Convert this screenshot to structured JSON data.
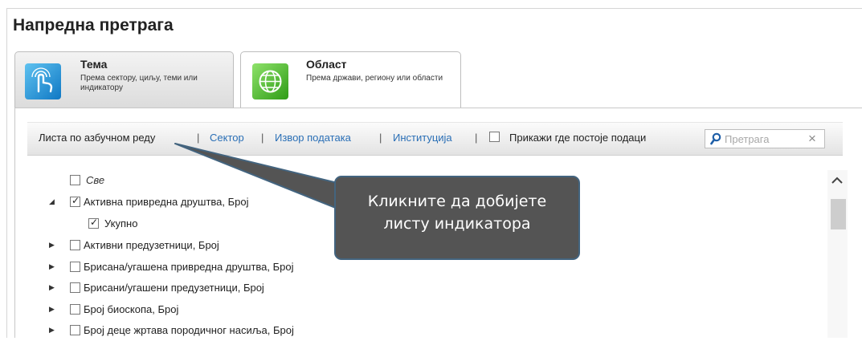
{
  "page": {
    "title": "Напредна претрага"
  },
  "tabs": [
    {
      "title": "Тема",
      "description": "Према сектору, циљу, теми или индикатору",
      "icon": "touch-hand-icon",
      "active": true
    },
    {
      "title": "Област",
      "description": "Према држави, региону или области",
      "icon": "globe-icon",
      "active": false
    }
  ],
  "toolbar": {
    "alphabetical": "Листа по азбучном реду",
    "separator": "|",
    "sector": "Сектор",
    "data_source": "Извор података",
    "institution": "Институција",
    "show_data_label": "Прикажи где постоје подаци",
    "search_placeholder": "Претрага",
    "clear_icon": "×"
  },
  "tree": {
    "all_label": "Све",
    "items": [
      {
        "label": "Активна привредна друштва, Број",
        "expanded": true,
        "checked": true
      },
      {
        "label": "Укупно",
        "child": true,
        "checked": true
      },
      {
        "label": "Активни предузетници, Број",
        "expanded": false,
        "checked": false
      },
      {
        "label": "Брисана/угашена привредна друштва, Број",
        "expanded": false,
        "checked": false
      },
      {
        "label": "Брисани/угашени предузетници, Број",
        "expanded": false,
        "checked": false
      },
      {
        "label": "Број биоскопа, Број",
        "expanded": false,
        "checked": false
      },
      {
        "label": "Број деце жртава породичног насиља, Број",
        "expanded": false,
        "checked": false
      }
    ]
  },
  "callout": {
    "line1": "Кликните да добијете",
    "line2": "листу индикатора"
  },
  "colors": {
    "link": "#2a6fb6",
    "callout_bg": "#545454",
    "callout_border": "#43647f"
  }
}
